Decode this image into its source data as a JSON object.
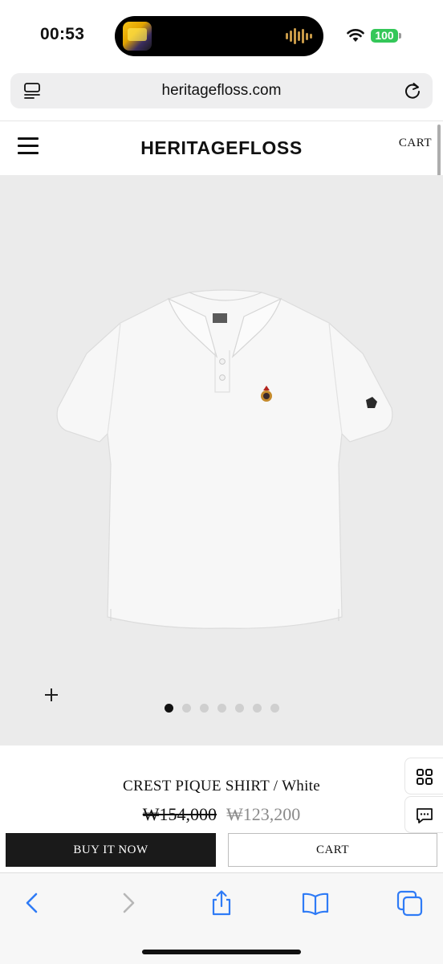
{
  "status_bar": {
    "time": "00:53",
    "battery": "100",
    "icons": [
      "now-playing-art",
      "audio-waveform-icon",
      "wifi-icon",
      "battery-icon"
    ]
  },
  "browser": {
    "url": "heritagefloss.com",
    "icons": [
      "tab-format-icon",
      "reload-icon"
    ]
  },
  "site_header": {
    "brand": "HERITAGEFLOSS",
    "cart_label": "CART",
    "icons": [
      "hamburger-menu-icon"
    ]
  },
  "gallery": {
    "image_subject": "white polo shirt",
    "dot_count": 7,
    "active_index": 0,
    "icons": [
      "zoom-plus-icon"
    ]
  },
  "product": {
    "title": "CREST PIQUE SHIRT / White",
    "price_original": "₩154,000",
    "price_sale": "₩123,200"
  },
  "side_buttons": {
    "icons": [
      "grid-icon",
      "chat-icon"
    ]
  },
  "actions": {
    "buy_now": "BUY IT NOW",
    "cart": "CART"
  },
  "toolbar": {
    "icons": [
      "back-icon",
      "forward-icon",
      "share-icon",
      "bookmarks-icon",
      "tabs-icon"
    ]
  },
  "colors": {
    "battery_green": "#34c759",
    "ios_blue": "#2f7bf6",
    "gallery_bg": "#ebebeb",
    "buy_button": "#1a1a1a",
    "sale_price": "#8a8a8a"
  }
}
